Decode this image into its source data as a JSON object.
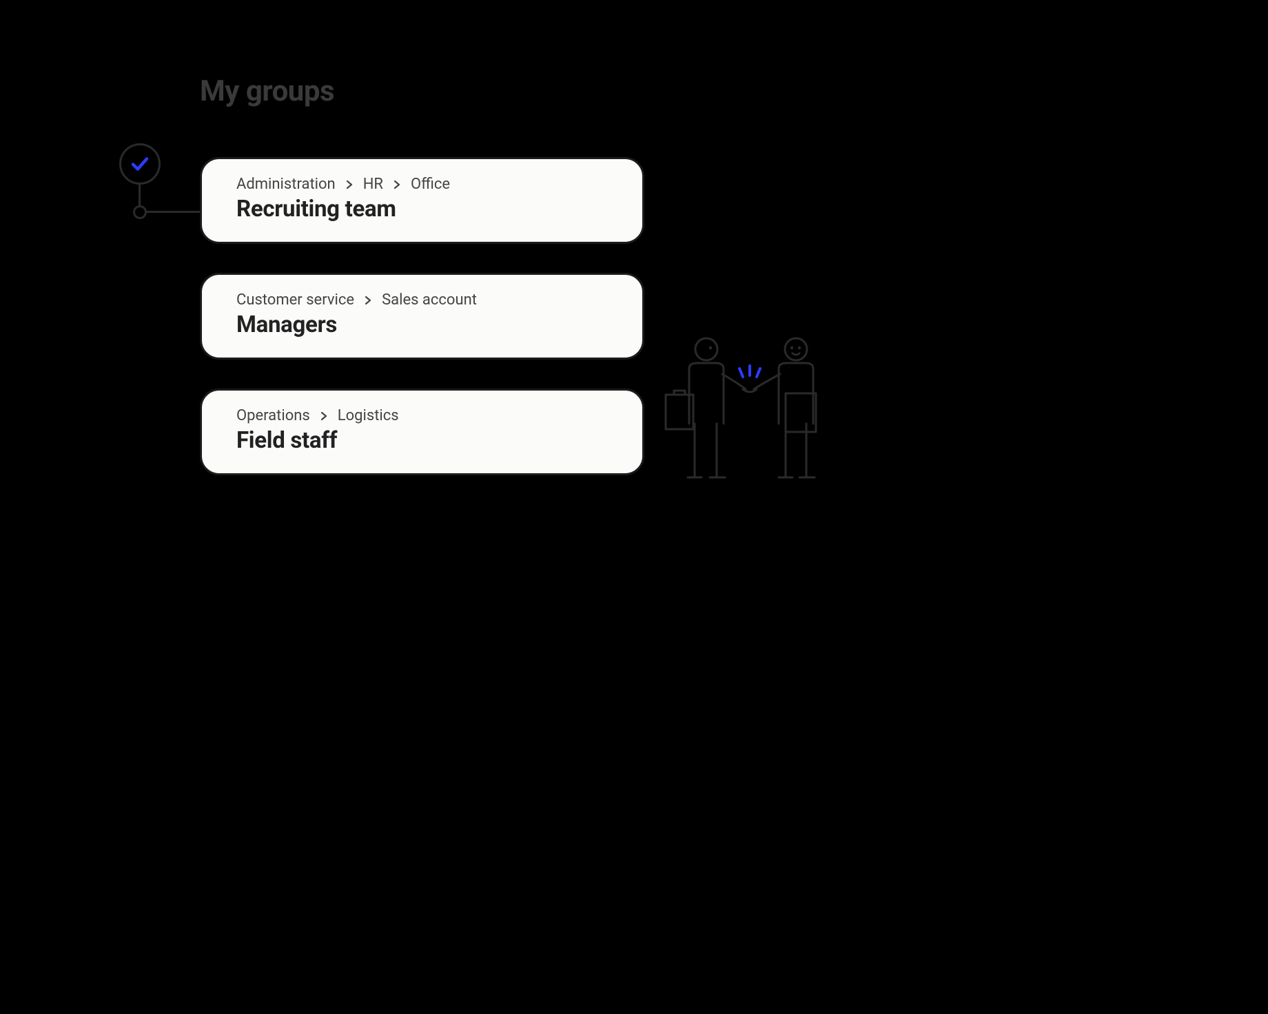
{
  "accent": "#2c3cff",
  "title": "My groups",
  "groups": [
    {
      "breadcrumb": [
        "Administration",
        "HR",
        "Office"
      ],
      "name": "Recruiting team"
    },
    {
      "breadcrumb": [
        "Customer service",
        "Sales account"
      ],
      "name": "Managers"
    },
    {
      "breadcrumb": [
        "Operations",
        "Logistics"
      ],
      "name": "Field staff"
    }
  ]
}
